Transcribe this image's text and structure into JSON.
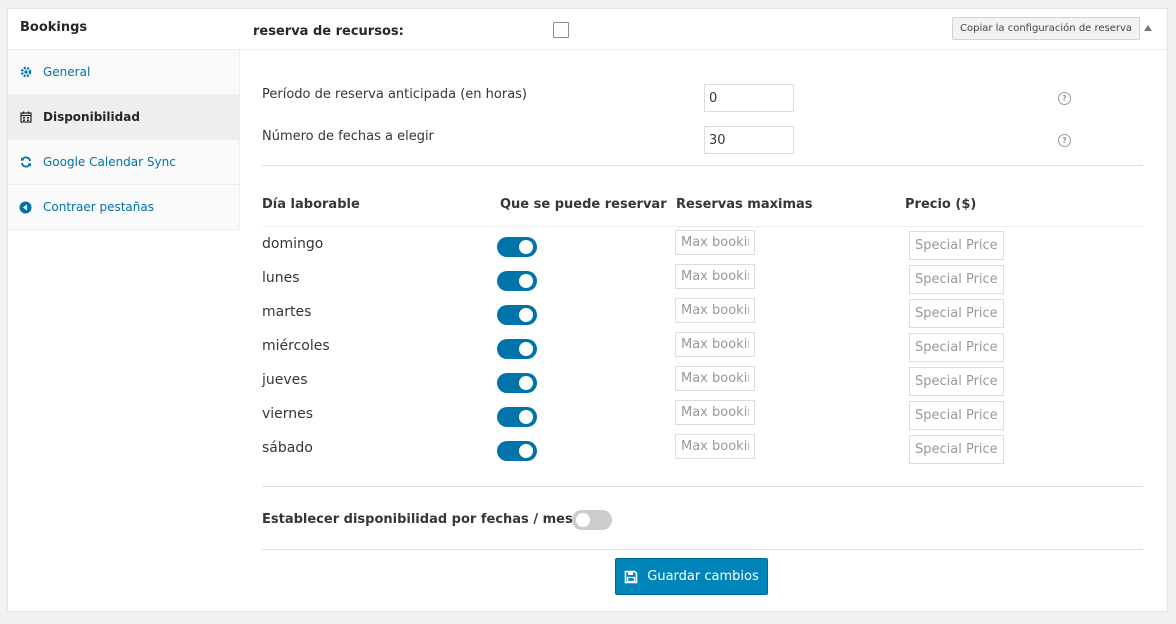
{
  "header": {
    "title": "Bookings",
    "resource_label": "reserva de recursos:",
    "copy_button": "Copiar la configuración de reserva"
  },
  "sidebar": {
    "items": [
      {
        "label": "General",
        "icon": "gear-icon"
      },
      {
        "label": "Disponibilidad",
        "icon": "calendar-icon"
      },
      {
        "label": "Google Calendar Sync",
        "icon": "sync-icon"
      },
      {
        "label": "Contraer pestañas",
        "icon": "collapse-icon"
      }
    ]
  },
  "fields": {
    "advance_label": "Período de reserva anticipada (en horas)",
    "advance_value": "0",
    "dates_label": "Número de fechas a elegir",
    "dates_value": "30",
    "help_glyph": "?"
  },
  "table": {
    "headers": [
      "Día laborable",
      "Que se puede reservar",
      "Reservas maximas",
      "Precio ($)"
    ],
    "max_placeholder": "Max bookings",
    "price_placeholder": "Special Price",
    "rows": [
      {
        "day": "domingo",
        "bookable": true
      },
      {
        "day": "lunes",
        "bookable": true
      },
      {
        "day": "martes",
        "bookable": true
      },
      {
        "day": "miércoles",
        "bookable": true
      },
      {
        "day": "jueves",
        "bookable": true
      },
      {
        "day": "viernes",
        "bookable": true
      },
      {
        "day": "sábado",
        "bookable": true
      }
    ]
  },
  "availability": {
    "label": "Establecer disponibilidad por fechas / meses",
    "enabled": false
  },
  "save_button": "Guardar cambios",
  "colors": {
    "accent": "#0073aa",
    "button": "#0085ba",
    "toggle_off": "#cccccc"
  }
}
